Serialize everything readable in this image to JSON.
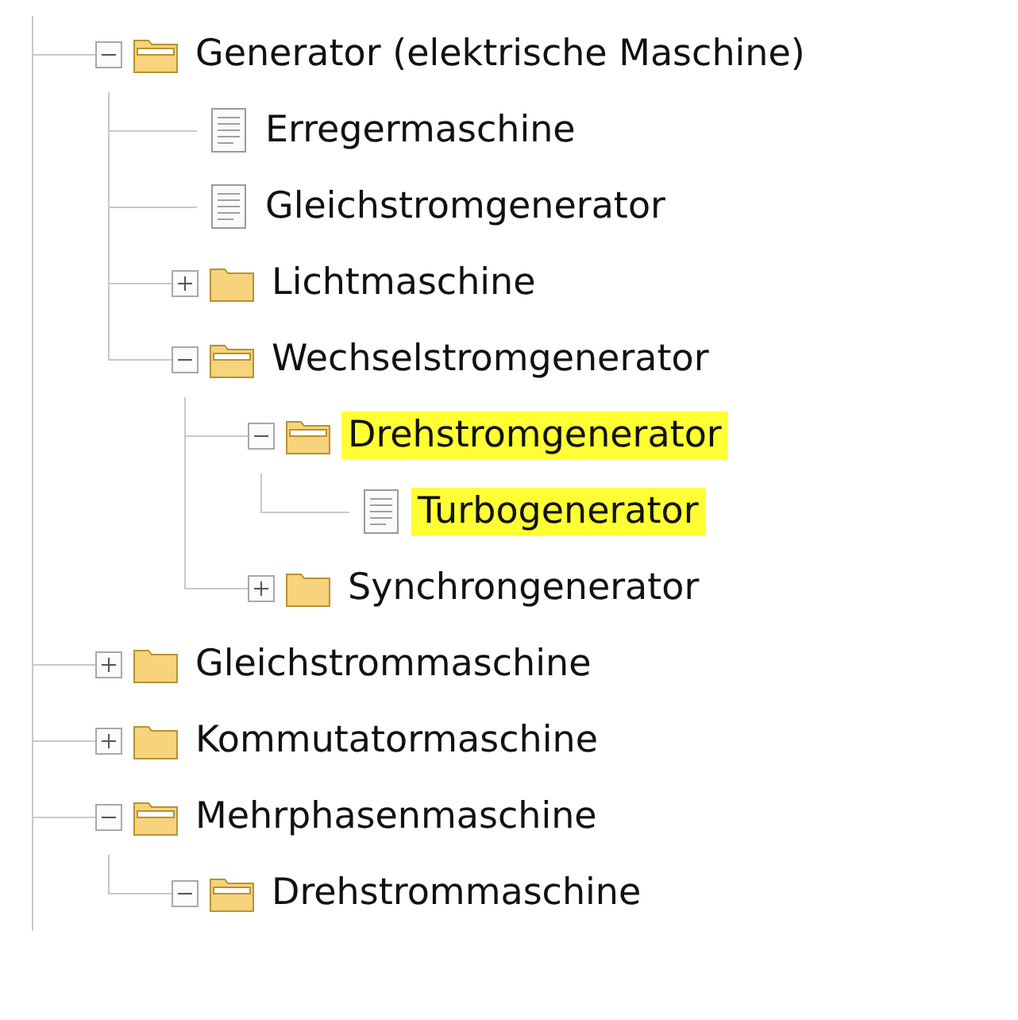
{
  "tree": {
    "nodes": [
      {
        "label": "Generator (elektrische Maschine)",
        "kind": "folder",
        "expanded": true,
        "highlighted": false,
        "children": [
          {
            "label": "Erregermaschine",
            "kind": "document",
            "highlighted": false
          },
          {
            "label": "Gleichstromgenerator",
            "kind": "document",
            "highlighted": false
          },
          {
            "label": "Lichtmaschine",
            "kind": "folder",
            "expanded": false,
            "highlighted": false
          },
          {
            "label": "Wechselstromgenerator",
            "kind": "folder",
            "expanded": true,
            "highlighted": false,
            "children": [
              {
                "label": "Drehstromgenerator",
                "kind": "folder",
                "expanded": true,
                "highlighted": true,
                "children": [
                  {
                    "label": "Turbogenerator",
                    "kind": "document",
                    "highlighted": true
                  }
                ]
              },
              {
                "label": "Synchrongenerator",
                "kind": "folder",
                "expanded": false,
                "highlighted": false
              }
            ]
          }
        ]
      },
      {
        "label": "Gleichstrommaschine",
        "kind": "folder",
        "expanded": false,
        "highlighted": false
      },
      {
        "label": "Kommutatormaschine",
        "kind": "folder",
        "expanded": false,
        "highlighted": false
      },
      {
        "label": "Mehrphasenmaschine",
        "kind": "folder",
        "expanded": true,
        "highlighted": false,
        "children": [
          {
            "label": "Drehstrommaschine",
            "kind": "folder",
            "expanded": true,
            "highlighted": false
          }
        ]
      }
    ]
  }
}
